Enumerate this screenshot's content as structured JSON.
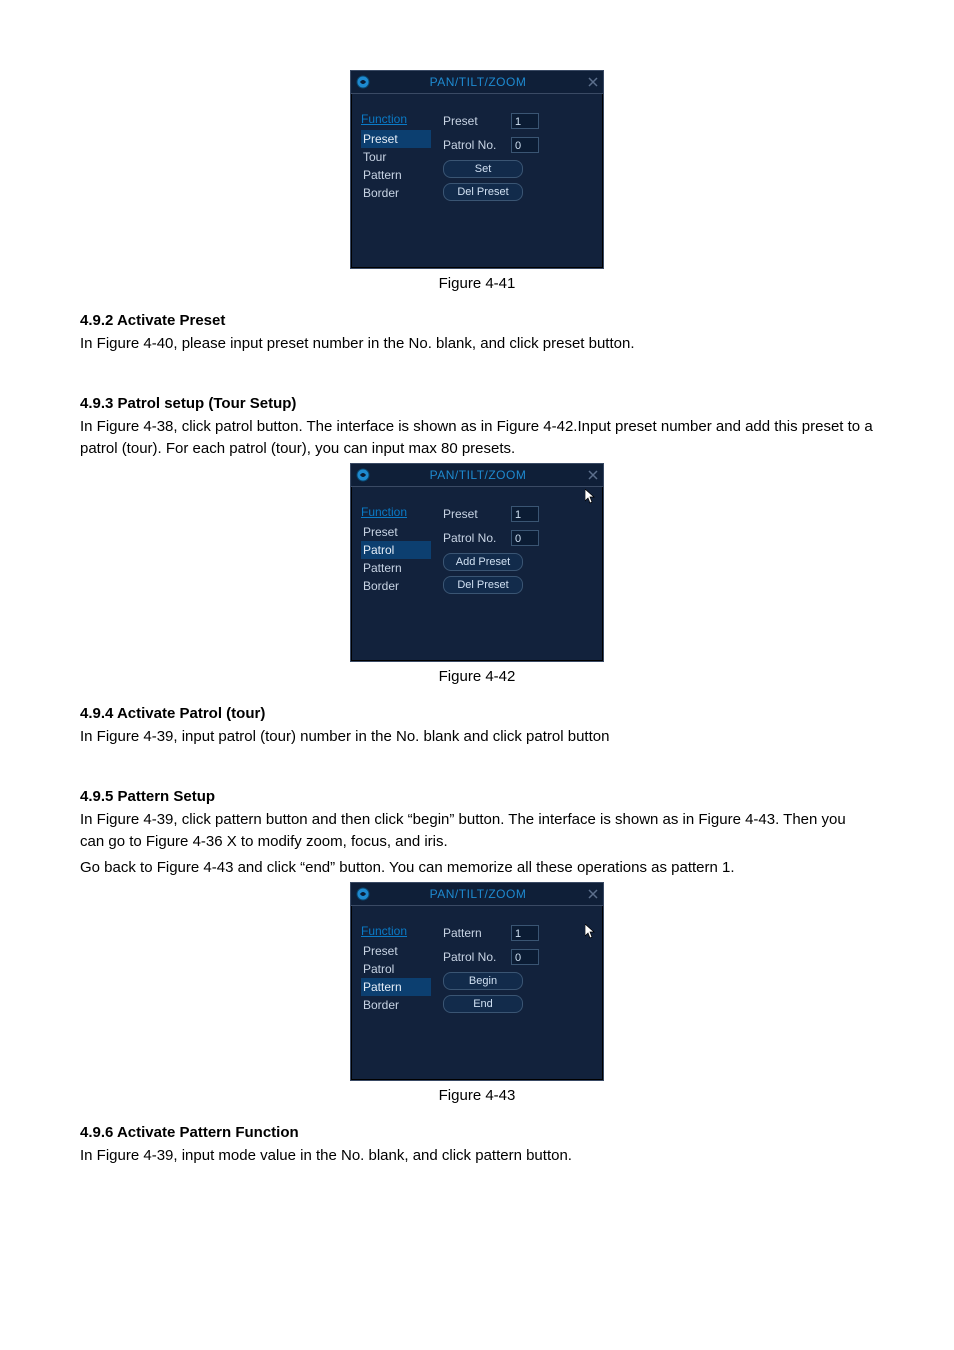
{
  "dialog41": {
    "title": "PAN/TILT/ZOOM",
    "func_header": "Function",
    "items": [
      "Preset",
      "Tour",
      "Pattern",
      "Border"
    ],
    "selected_index": 0,
    "right": {
      "label1": "Preset",
      "value1": "1",
      "label2": "Patrol No.",
      "value2": "0",
      "button1": "Set",
      "button2": "Del Preset"
    }
  },
  "caption41": "Figure 4-41",
  "sec492": {
    "heading": "4.9.2 Activate Preset",
    "para": "In Figure 4-40, please input preset number in the No. blank, and click preset button."
  },
  "sec493": {
    "heading": "4.9.3 Patrol setup (Tour Setup)",
    "para": "In Figure 4-38, click patrol button. The interface is shown as in Figure 4-42.Input preset number and add this preset to a patrol (tour). For each patrol (tour), you can input max 80 presets."
  },
  "dialog42": {
    "title": "PAN/TILT/ZOOM",
    "func_header": "Function",
    "items": [
      "Preset",
      "Patrol",
      "Pattern",
      "Border"
    ],
    "selected_index": 1,
    "right": {
      "label1": "Preset",
      "value1": "1",
      "label2": "Patrol No.",
      "value2": "0",
      "button1": "Add Preset",
      "button2": "Del Preset"
    },
    "show_cursor": true
  },
  "caption42": "Figure 4-42",
  "sec494": {
    "heading": "4.9.4 Activate Patrol (tour)",
    "para": "In  Figure 4-39, input patrol (tour) number in the No. blank and click patrol button"
  },
  "sec495": {
    "heading": "4.9.5 Pattern Setup",
    "para1": "In Figure 4-39, click pattern button and then click “begin” button. The interface is shown as in Figure 4-43. Then you can go to Figure 4-36 X to modify zoom, focus, and iris.",
    "para2": "Go back to Figure 4-43 and click “end” button. You can memorize all these operations as pattern 1."
  },
  "dialog43": {
    "title": "PAN/TILT/ZOOM",
    "func_header": "Function",
    "items": [
      "Preset",
      "Patrol",
      "Pattern",
      "Border"
    ],
    "selected_index": 2,
    "right": {
      "label1": "Pattern",
      "value1": "1",
      "label2": "Patrol No.",
      "value2": "0",
      "button1": "Begin",
      "button2": "End"
    },
    "show_cursor": true
  },
  "caption43": "Figure 4-43",
  "sec496": {
    "heading": "4.9.6 Activate Pattern Function",
    "para": "In  Figure 4-39, input mode value in the No. blank, and click pattern button."
  }
}
